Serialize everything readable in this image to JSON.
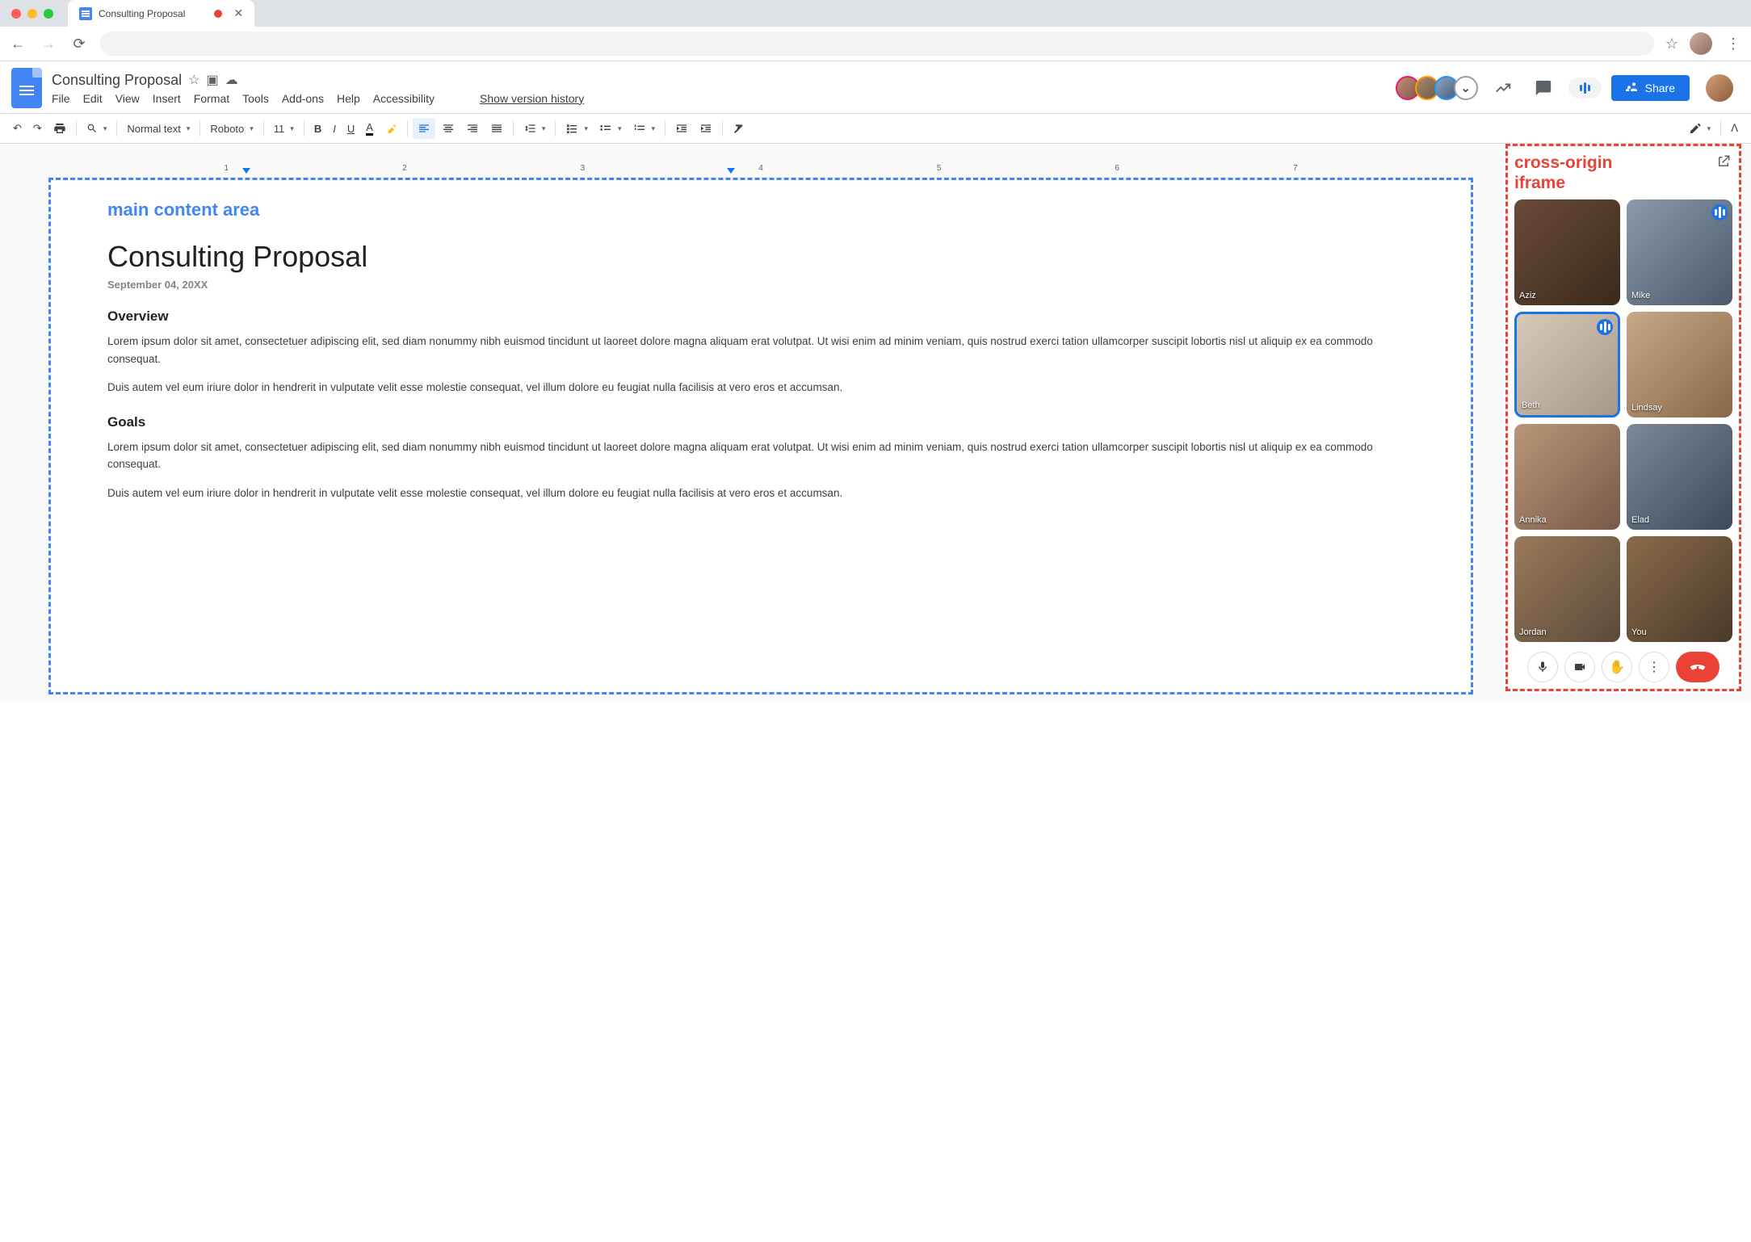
{
  "browser": {
    "tab_title": "Consulting Proposal",
    "recording": true
  },
  "header": {
    "doc_title": "Consulting Proposal",
    "menus": [
      "File",
      "Edit",
      "View",
      "Insert",
      "Format",
      "Tools",
      "Add-ons",
      "Help",
      "Accessibility"
    ],
    "version_history": "Show version history",
    "share_label": "Share",
    "presence_extra": "⌄"
  },
  "toolbar": {
    "zoom": "",
    "style": "Normal text",
    "font": "Roboto",
    "size": "11"
  },
  "ruler": [
    "1",
    "2",
    "3",
    "4",
    "5",
    "6",
    "7"
  ],
  "annotations": {
    "main": "main content area",
    "iframe_l1": "cross-origin",
    "iframe_l2": "iframe"
  },
  "document": {
    "title": "Consulting Proposal",
    "date": "September 04, 20XX",
    "overview_h": "Overview",
    "overview_p1": "Lorem ipsum dolor sit amet, consectetuer adipiscing elit, sed diam nonummy nibh euismod tincidunt ut laoreet dolore magna aliquam erat volutpat. Ut wisi enim ad minim veniam, quis nostrud exerci tation ullamcorper suscipit lobortis nisl ut aliquip ex ea commodo consequat.",
    "overview_p2": "Duis autem vel eum iriure dolor in hendrerit in vulputate velit esse molestie consequat, vel illum dolore eu feugiat nulla facilisis at vero eros et accumsan.",
    "goals_h": "Goals",
    "goals_p1": "Lorem ipsum dolor sit amet, consectetuer adipiscing elit, sed diam nonummy nibh euismod tincidunt ut laoreet dolore magna aliquam erat volutpat. Ut wisi enim ad minim veniam, quis nostrud exerci tation ullamcorper suscipit lobortis nisl ut aliquip ex ea commodo consequat.",
    "goals_p2": "Duis autem vel eum iriure dolor in hendrerit in vulputate velit esse molestie consequat, vel illum dolore eu feugiat nulla facilisis at vero eros et accumsan."
  },
  "meet": {
    "participants": [
      {
        "name": "Aziz",
        "talking": false,
        "cls": "v-aziz"
      },
      {
        "name": "Mike",
        "talking": true,
        "cls": "v-mike"
      },
      {
        "name": "Beth",
        "talking": true,
        "cls": "v-beth",
        "active": true
      },
      {
        "name": "Lindsay",
        "talking": false,
        "cls": "v-lindsay"
      },
      {
        "name": "Annika",
        "talking": false,
        "cls": "v-annika"
      },
      {
        "name": "Elad",
        "talking": false,
        "cls": "v-elad"
      },
      {
        "name": "Jordan",
        "talking": false,
        "cls": "v-jordan"
      },
      {
        "name": "You",
        "talking": false,
        "cls": "v-you"
      }
    ]
  }
}
